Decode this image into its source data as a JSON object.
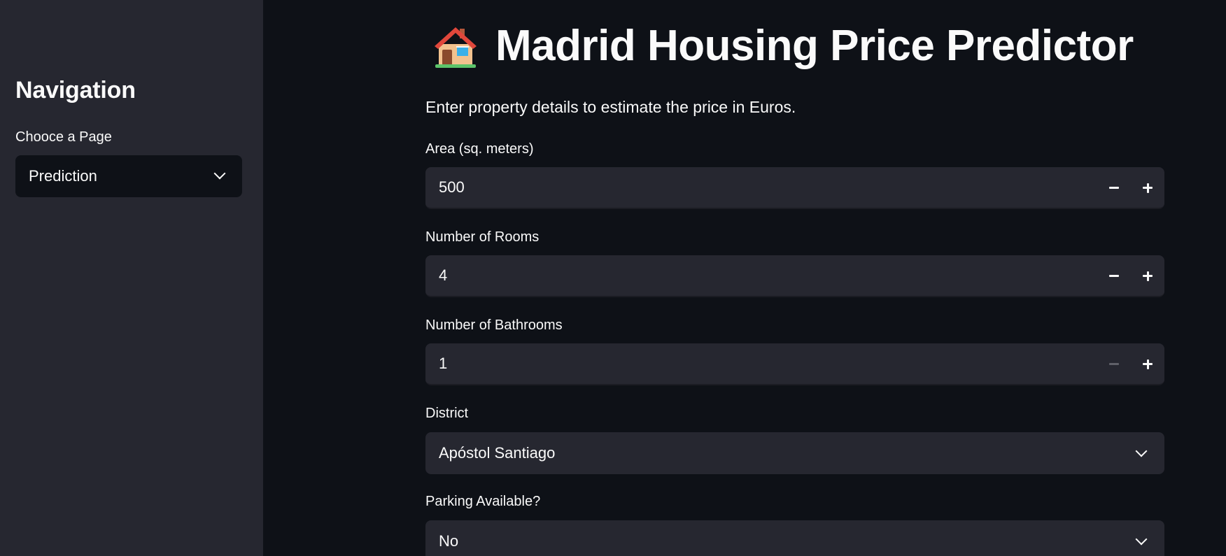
{
  "sidebar": {
    "title": "Navigation",
    "select_label": "Chooce a Page",
    "select_value": "Prediction"
  },
  "main": {
    "title": "Madrid Housing Price Predictor",
    "title_icon": "house-icon",
    "subtitle": "Enter property details to estimate the price in Euros.",
    "fields": {
      "area": {
        "label": "Area (sq. meters)",
        "value": "500"
      },
      "rooms": {
        "label": "Number of Rooms",
        "value": "4"
      },
      "bathrooms": {
        "label": "Number of Bathrooms",
        "value": "1"
      },
      "district": {
        "label": "District",
        "value": "Apóstol Santiago"
      },
      "parking": {
        "label": "Parking Available?",
        "value": "No"
      }
    }
  },
  "colors": {
    "background": "#0e1117",
    "sidebar": "#262730",
    "input": "#262730",
    "text": "#fafafa",
    "disabled": "#5f6068"
  }
}
